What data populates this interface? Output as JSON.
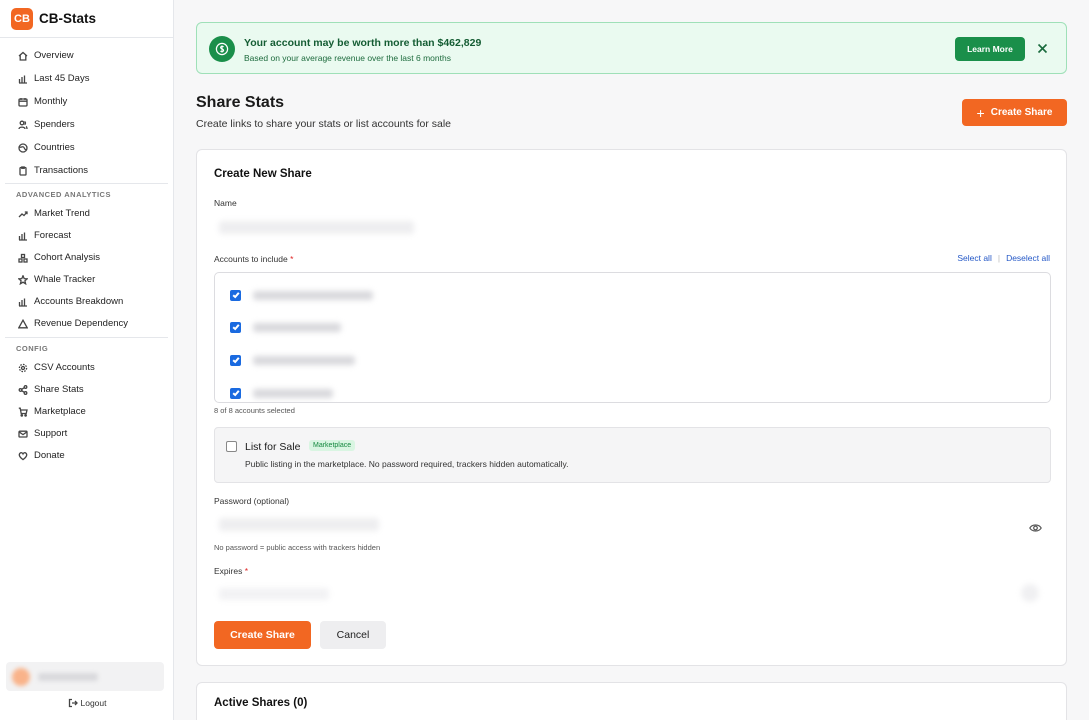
{
  "app": {
    "logo_text": "CB",
    "name": "CB-Stats"
  },
  "sidebar": {
    "main_items": [
      {
        "label": "Overview",
        "icon": "home-icon"
      },
      {
        "label": "Last 45 Days",
        "icon": "bar-chart-icon"
      },
      {
        "label": "Monthly",
        "icon": "calendar-icon"
      },
      {
        "label": "Spenders",
        "icon": "users-icon"
      },
      {
        "label": "Countries",
        "icon": "globe-icon"
      },
      {
        "label": "Transactions",
        "icon": "clipboard-icon"
      }
    ],
    "advanced_label": "ADVANCED ANALYTICS",
    "advanced_items": [
      {
        "label": "Market Trend",
        "icon": "trend-icon"
      },
      {
        "label": "Forecast",
        "icon": "bar-chart-icon"
      },
      {
        "label": "Cohort Analysis",
        "icon": "layers-icon"
      },
      {
        "label": "Whale Tracker",
        "icon": "star-icon"
      },
      {
        "label": "Accounts Breakdown",
        "icon": "bar-chart-icon"
      },
      {
        "label": "Revenue Dependency",
        "icon": "triangle-icon"
      }
    ],
    "config_label": "CONFIG",
    "config_items": [
      {
        "label": "CSV Accounts",
        "icon": "gear-icon"
      },
      {
        "label": "Share Stats",
        "icon": "share-icon"
      },
      {
        "label": "Marketplace",
        "icon": "cart-icon"
      },
      {
        "label": "Support",
        "icon": "mail-icon"
      },
      {
        "label": "Donate",
        "icon": "heart-icon"
      }
    ],
    "logout_label": "Logout"
  },
  "banner": {
    "title": "Your account may be worth more than $462,829",
    "subtitle": "Based on your average revenue over the last 6 months",
    "button_label": "Learn More"
  },
  "page": {
    "title": "Share Stats",
    "subtitle": "Create links to share your stats or list accounts for sale",
    "create_button_label": "Create Share"
  },
  "form": {
    "title": "Create New Share",
    "name_label": "Name",
    "accounts_label": "Accounts to include",
    "required_mark": "*",
    "select_all_label": "Select all",
    "deselect_all_label": "Deselect all",
    "accounts_selected_text": "8 of 8 accounts selected",
    "list_for_sale_label": "List for Sale",
    "marketplace_badge": "Marketplace",
    "list_for_sale_desc": "Public listing in the marketplace. No password required, trackers hidden automatically.",
    "password_label": "Password (optional)",
    "password_hint": "No password = public access with trackers hidden",
    "expires_label": "Expires",
    "submit_label": "Create Share",
    "cancel_label": "Cancel"
  },
  "active_shares": {
    "title": "Active Shares (0)"
  },
  "colors": {
    "accent": "#f26722",
    "success": "#1a8f4a",
    "link": "#2458c7"
  }
}
